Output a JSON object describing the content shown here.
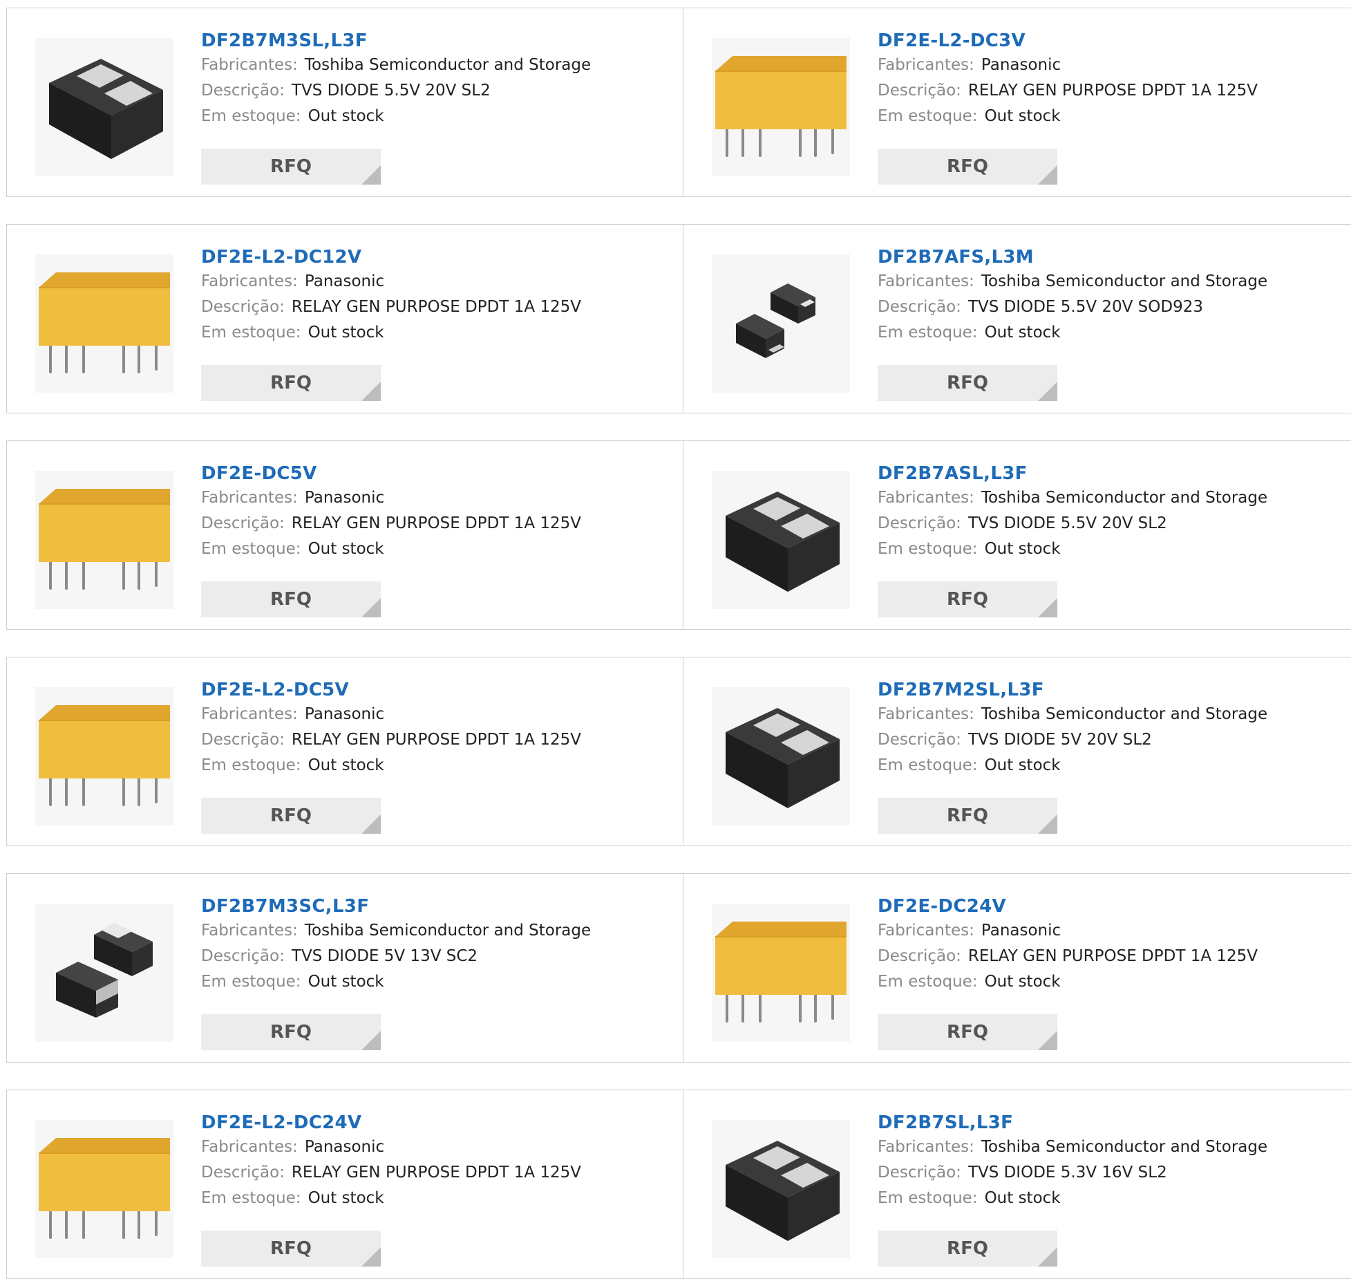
{
  "labels": {
    "manufacturer": "Fabricantes:",
    "description": "Descrição:",
    "stock": "Em estoque:",
    "rfq": "RFQ"
  },
  "products": [
    {
      "part": "DF2B7M3SL,L3F",
      "manufacturer": "Toshiba Semiconductor and Storage",
      "description": "TVS DIODE 5.5V 20V SL2",
      "stock": "Out stock",
      "image": "diode-sl2"
    },
    {
      "part": "DF2E-L2-DC3V",
      "manufacturer": "Panasonic",
      "description": "RELAY GEN PURPOSE DPDT 1A 125V",
      "stock": "Out stock",
      "image": "relay"
    },
    {
      "part": "DF2E-L2-DC12V",
      "manufacturer": "Panasonic",
      "description": "RELAY GEN PURPOSE DPDT 1A 125V",
      "stock": "Out stock",
      "image": "relay"
    },
    {
      "part": "DF2B7AFS,L3M",
      "manufacturer": "Toshiba Semiconductor and Storage",
      "description": "TVS DIODE 5.5V 20V SOD923",
      "stock": "Out stock",
      "image": "diode-sod923"
    },
    {
      "part": "DF2E-DC5V",
      "manufacturer": "Panasonic",
      "description": "RELAY GEN PURPOSE DPDT 1A 125V",
      "stock": "Out stock",
      "image": "relay"
    },
    {
      "part": "DF2B7ASL,L3F",
      "manufacturer": "Toshiba Semiconductor and Storage",
      "description": "TVS DIODE 5.5V 20V SL2",
      "stock": "Out stock",
      "image": "diode-sl2"
    },
    {
      "part": "DF2E-L2-DC5V",
      "manufacturer": "Panasonic",
      "description": "RELAY GEN PURPOSE DPDT 1A 125V",
      "stock": "Out stock",
      "image": "relay"
    },
    {
      "part": "DF2B7M2SL,L3F",
      "manufacturer": "Toshiba Semiconductor and Storage",
      "description": "TVS DIODE 5V 20V SL2",
      "stock": "Out stock",
      "image": "diode-sl2"
    },
    {
      "part": "DF2B7M3SC,L3F",
      "manufacturer": "Toshiba Semiconductor and Storage",
      "description": "TVS DIODE 5V 13V SC2",
      "stock": "Out stock",
      "image": "diode-sc2"
    },
    {
      "part": "DF2E-DC24V",
      "manufacturer": "Panasonic",
      "description": "RELAY GEN PURPOSE DPDT 1A 125V",
      "stock": "Out stock",
      "image": "relay"
    },
    {
      "part": "DF2E-L2-DC24V",
      "manufacturer": "Panasonic",
      "description": "RELAY GEN PURPOSE DPDT 1A 125V",
      "stock": "Out stock",
      "image": "relay"
    },
    {
      "part": "DF2B7SL,L3F",
      "manufacturer": "Toshiba Semiconductor and Storage",
      "description": "TVS DIODE 5.3V 16V SL2",
      "stock": "Out stock",
      "image": "diode-sl2"
    }
  ],
  "colors": {
    "link": "#1e6bb8",
    "label": "#8a8a8a",
    "border": "#cfcfcf",
    "rfq_bg": "#ececec"
  }
}
